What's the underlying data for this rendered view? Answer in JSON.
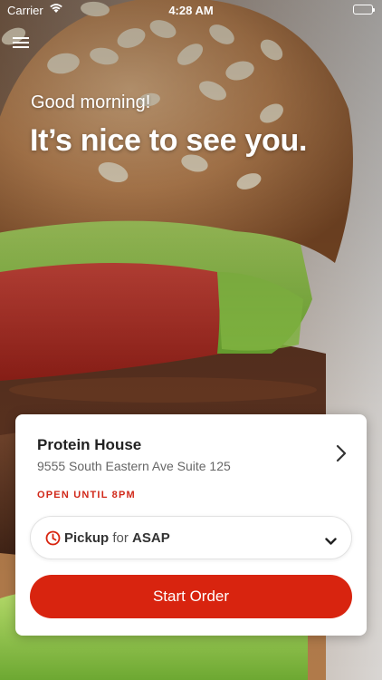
{
  "status_bar": {
    "carrier": "Carrier",
    "time": "4:28 AM",
    "wifi_icon": "wifi-icon",
    "battery_icon": "battery-icon"
  },
  "header": {
    "menu_icon": "hamburger-menu-icon",
    "greeting": "Good morning!",
    "headline": "It’s nice to see you."
  },
  "location_card": {
    "store_name": "Protein House",
    "address": "9555 South Eastern Ave Suite 125",
    "hours": "OPEN UNTIL 8PM",
    "chevron_icon": "chevron-right-icon",
    "pickup": {
      "clock_icon": "clock-icon",
      "mode": "Pickup",
      "connector": "for",
      "time": "ASAP",
      "dropdown_icon": "chevron-down-icon"
    },
    "start_order_label": "Start Order"
  },
  "colors": {
    "accent": "#d8240f",
    "hours_text": "#d1291a",
    "card_background": "#ffffff"
  }
}
